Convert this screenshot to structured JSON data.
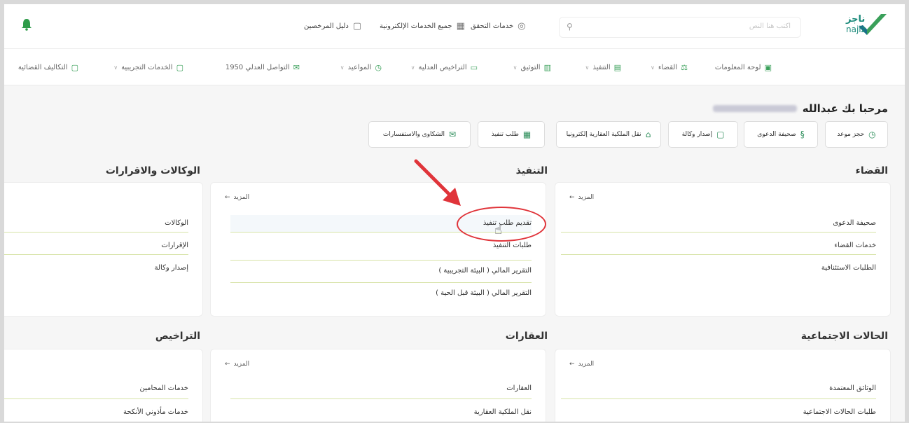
{
  "header": {
    "logo_line1": "ناجز",
    "logo_line2": "najiz",
    "search_placeholder": "اكتب هنا النص",
    "links": {
      "verify": "خدمات التحقق",
      "all_services": "جميع الخدمات الإلكترونية",
      "licensees_guide": "دليل المرخصين"
    }
  },
  "nav": {
    "items": [
      "لوحة المعلومات",
      "القضاء",
      "التنفيذ",
      "التوثيق",
      "التراخيص العدلية",
      "المواعيد",
      "التواصل العدلي 1950",
      "الخدمات التجريبية",
      "التكاليف القضائية"
    ]
  },
  "welcome": {
    "text": "مرحبا بك عبدالله"
  },
  "quick": {
    "book_appointment": "حجز موعد",
    "case_sheet": "صحيفة الدعوى",
    "issue_poa": "إصدار وكالة",
    "transfer_property": "نقل الملكية العقارية إلكترونيا",
    "execution_request": "طلب تنفيذ",
    "complaints": "الشكاوى والاستفسارات"
  },
  "more_label": "المزيد",
  "sections": {
    "judiciary": {
      "title": "القضاء",
      "items": [
        "صحيفة الدعوى",
        "خدمات القضاء",
        "الطلبات الاستئنافية"
      ]
    },
    "execution": {
      "title": "التنفيذ",
      "items": [
        "تقديم طلب تنفيذ",
        "طلبات التنفيذ",
        "التقرير المالي ( البيئة التجريبية )",
        "التقرير المالي ( البيئة قبل الحية )"
      ]
    },
    "poa": {
      "title": "الوكالات والاقرارات",
      "items": [
        "الوكالات",
        "الإقرارات",
        "إصدار وكالة"
      ]
    },
    "social": {
      "title": "الحالات الاجتماعية",
      "items": [
        "الوثائق المعتمدة",
        "طلبات الحالات الاجتماعية"
      ]
    },
    "realestate": {
      "title": "العقارات",
      "items": [
        "العقارات",
        "نقل الملكية العقارية"
      ]
    },
    "licenses": {
      "title": "التراخيص",
      "items": [
        "خدمات المحامين",
        "خدمات مأذوني الأنكحة"
      ]
    }
  },
  "colors": {
    "brand": "#1a8a7a",
    "accent": "#3aa05a",
    "annotation": "#e0343a"
  }
}
